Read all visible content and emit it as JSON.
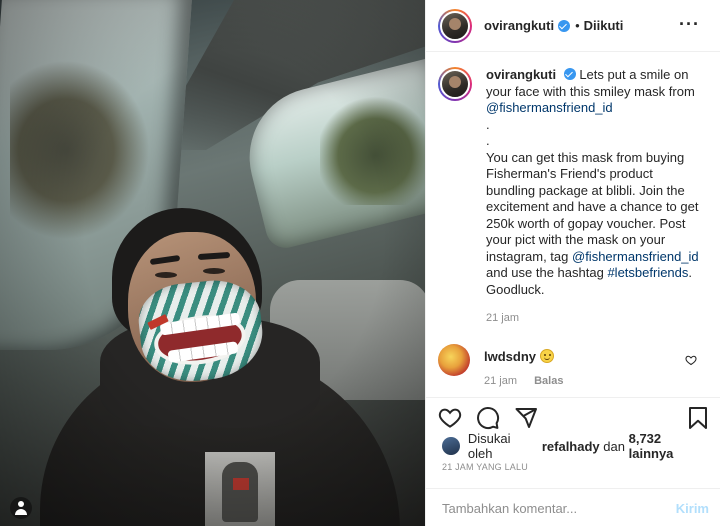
{
  "header": {
    "username": "ovirangkuti",
    "separator": "•",
    "follow_status": "Diikuti",
    "more_icon": "more-horizontal-icon"
  },
  "caption": {
    "username": "ovirangkuti",
    "intro": "Lets put a smile on your face with this smiley mask from",
    "mention_1": "@fishermansfriend_id",
    "spacer": "\n.\n.\n",
    "body": "You can get this mask from buying Fisherman's Friend's product bundling package at blibli. Join the excitement and have a chance to get 250k worth of gopay voucher. Post your pict with the mask on your instagram, tag",
    "mention_2": "@fishermansfriend_id",
    "mid": "and use the hashtag",
    "hashtag": "#letsbefriends",
    "outro": ". Goodluck.",
    "time": "21 jam"
  },
  "comment": {
    "username": "lwdsdny",
    "emoji": "smiling-face-emoji",
    "time": "21 jam",
    "reply_label": "Balas"
  },
  "likes": {
    "prefix": "Disukai oleh",
    "user": "refalhady",
    "conjunction": "dan",
    "others": "8,732 lainnya"
  },
  "timestamp": "21 JAM YANG LALU",
  "add_comment": {
    "placeholder": "Tambahkan komentar...",
    "post_label": "Kirim"
  },
  "colors": {
    "link": "#00376b",
    "verified": "#3897f0",
    "post_disabled": "#b2dffc",
    "muted": "#8e8e8e"
  }
}
